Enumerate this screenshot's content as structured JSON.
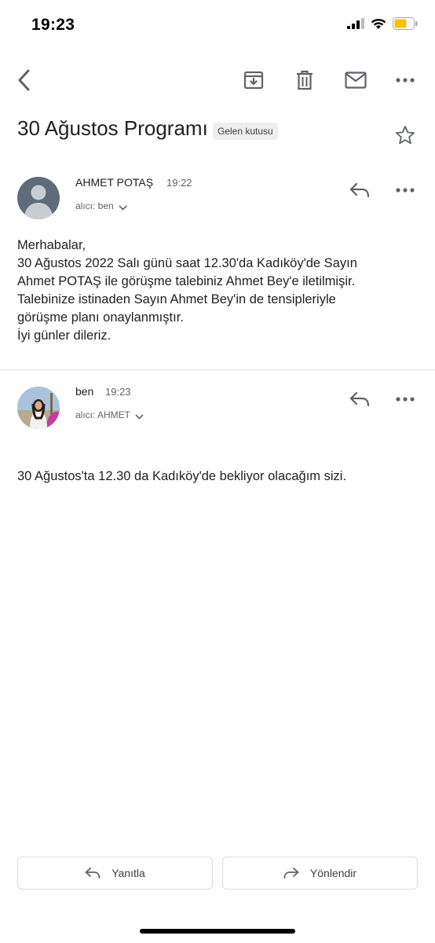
{
  "status_bar": {
    "time": "19:23"
  },
  "email": {
    "subject": "30 Ağustos Programı",
    "label": "Gelen kutusu"
  },
  "messages": [
    {
      "sender": "AHMET POTAŞ",
      "time": "19:22",
      "recipient": "alıcı: ben",
      "body": [
        "Merhabalar,",
        "30 Ağustos 2022 Salı günü saat 12.30'da Kadıköy'de Sayın",
        "Ahmet POTAŞ ile görüşme talebiniz Ahmet Bey'e iletilmişir.",
        "Talebinize istinaden Sayın Ahmet Bey'in de tensipleriyle",
        "görüşme planı onaylanmıştır.",
        "İyi günler dileriz."
      ]
    },
    {
      "sender": "ben",
      "time": "19:23",
      "recipient": "alıcı: AHMET",
      "body": [
        "30 Ağustos'ta 12.30 da Kadıköy'de bekliyor olacağım sizi."
      ]
    }
  ],
  "footer": {
    "reply_label": "Yanıtla",
    "forward_label": "Yönlendir"
  },
  "colors": {
    "icon": "#5f6368",
    "text": "#202124",
    "battery": "#f5c400"
  }
}
